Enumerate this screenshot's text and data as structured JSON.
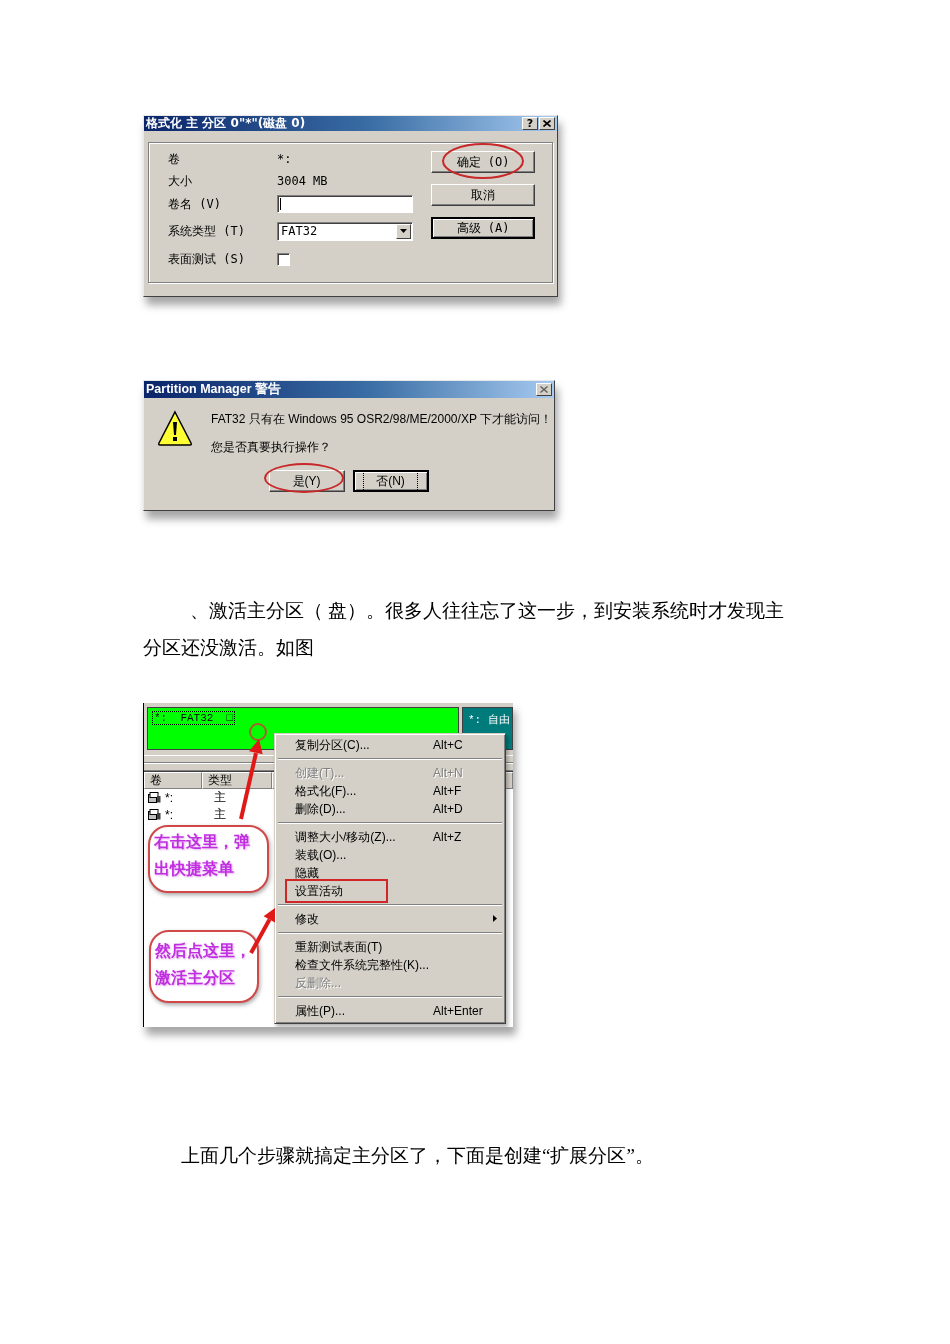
{
  "format_dialog": {
    "title": "格式化 主 分区 0\"*\"(磁盘 0)",
    "help_button": "?",
    "fields": [
      {
        "kind": "text",
        "label": "卷",
        "value": "*:"
      },
      {
        "kind": "text",
        "label": "大小",
        "value": "3004 MB"
      },
      {
        "kind": "input",
        "label": "卷名 (V)",
        "focused": true
      },
      {
        "kind": "select",
        "label": "系统类型 (T)",
        "value": "FAT32"
      },
      {
        "kind": "checkbox",
        "label": "表面测试 (S)",
        "checked": false
      }
    ],
    "buttons": [
      {
        "label": "确定 (O)",
        "default": false,
        "circled": true
      },
      {
        "label": "取消",
        "default": false,
        "circled": false
      },
      {
        "label": "高级 (A)",
        "default": true,
        "circled": false
      }
    ]
  },
  "warning_dialog": {
    "title": "Partition Manager 警告",
    "message": [
      "FAT32 只有在 Windows 95 OSR2/98/ME/2000/XP 下才能访问！",
      "您是否真要执行操作？"
    ],
    "buttons": [
      {
        "label": "是(Y)",
        "default": false,
        "circled": true
      },
      {
        "label": "否(N)",
        "default": true,
        "circled": false
      }
    ]
  },
  "step_text": "、激活主分区（ 盘）。很多人往往忘了这一步，到安装系统时才发现主分区还没激活。如图",
  "partition_window": {
    "partitions": [
      {
        "label": "*:  FAT32  □",
        "color": "#00ff00",
        "selected": true
      },
      {
        "label": "*: 自由",
        "color": "#007b7b",
        "selected": false
      }
    ],
    "columns": [
      "卷",
      "类型"
    ],
    "rows": [
      {
        "cells": [
          "*:",
          "主"
        ]
      },
      {
        "cells": [
          "*:",
          "主"
        ]
      }
    ],
    "context_menu": {
      "sections": [
        {
          "items": [
            {
              "kind": "command",
              "label": "复制分区(C)...",
              "shortcut": "Alt+C",
              "disabled": false,
              "marked": false
            }
          ]
        },
        {
          "items": [
            {
              "kind": "command",
              "label": "创建(T)...",
              "shortcut": "Alt+N",
              "disabled": true,
              "marked": false
            },
            {
              "kind": "command",
              "label": "格式化(F)...",
              "shortcut": "Alt+F",
              "disabled": false,
              "marked": false
            },
            {
              "kind": "command",
              "label": "删除(D)...",
              "shortcut": "Alt+D",
              "disabled": false,
              "marked": false
            }
          ]
        },
        {
          "items": [
            {
              "kind": "command",
              "label": "调整大小/移动(Z)...",
              "shortcut": "Alt+Z",
              "disabled": false,
              "marked": false
            },
            {
              "kind": "command",
              "label": "装载(O)...",
              "disabled": false,
              "marked": false
            },
            {
              "kind": "command",
              "label": "隐藏",
              "disabled": false,
              "marked": false
            },
            {
              "kind": "command",
              "label": "设置活动",
              "disabled": false,
              "marked": true
            }
          ]
        },
        {
          "items": [
            {
              "kind": "submenu",
              "label": "修改",
              "disabled": false,
              "marked": false
            }
          ]
        },
        {
          "items": [
            {
              "kind": "command",
              "label": "重新测试表面(T)",
              "disabled": false,
              "marked": false
            },
            {
              "kind": "command",
              "label": "检查文件系统完整性(K)...",
              "disabled": false,
              "marked": false
            },
            {
              "kind": "command",
              "label": "反删除...",
              "disabled": true,
              "marked": false
            }
          ]
        },
        {
          "items": [
            {
              "kind": "command",
              "label": "属性(P)...",
              "shortcut": "Alt+Enter",
              "disabled": false,
              "marked": false
            }
          ]
        }
      ]
    },
    "callouts": [
      {
        "text": "右击这里，弹出快捷菜单"
      },
      {
        "text": "然后点这里，激活主分区"
      }
    ]
  },
  "closing_text": "上面几个步骤就搞定主分区了，下面是创建“扩展分区”。"
}
